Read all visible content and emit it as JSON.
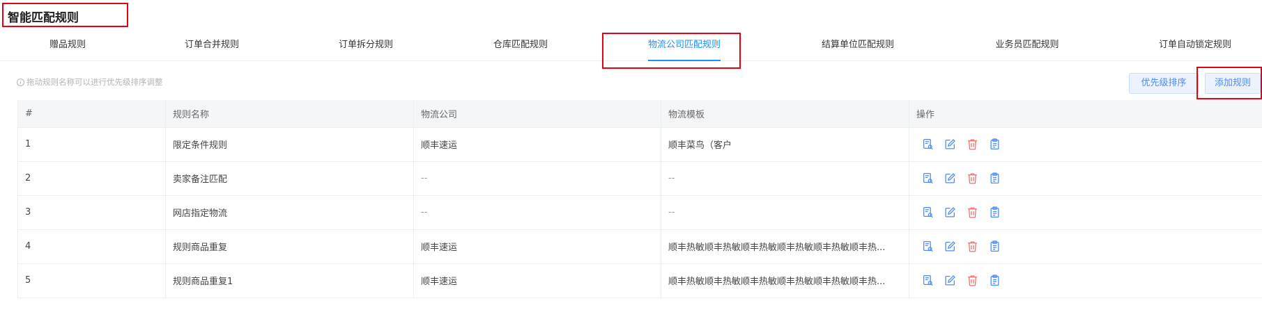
{
  "page": {
    "title": "智能匹配规则"
  },
  "colors": {
    "accent": "#1890ff",
    "highlight": "#e60012",
    "delete": "#f56c6c",
    "icon": "#4a8cf7"
  },
  "tabs": [
    {
      "label": "赠品规则",
      "active": false
    },
    {
      "label": "订单合并规则",
      "active": false
    },
    {
      "label": "订单拆分规则",
      "active": false
    },
    {
      "label": "仓库匹配规则",
      "active": false
    },
    {
      "label": "物流公司匹配规则",
      "active": true
    },
    {
      "label": "结算单位匹配规则",
      "active": false
    },
    {
      "label": "业务员匹配规则",
      "active": false
    },
    {
      "label": "订单自动锁定规则",
      "active": false
    }
  ],
  "toolbar": {
    "hint": "拖动规则名称可以进行优先级排序调整",
    "hint_icon": "info-circle-icon",
    "priority_label": "优先级排序",
    "add_label": "添加规则"
  },
  "table": {
    "headers": [
      "#",
      "规则名称",
      "物流公司",
      "物流模板",
      "操作"
    ],
    "rows": [
      {
        "index": "1",
        "name": "限定条件规则",
        "company": "顺丰速运",
        "template": "顺丰菜鸟（客户"
      },
      {
        "index": "2",
        "name": "卖家备注匹配",
        "company": "--",
        "template": "--"
      },
      {
        "index": "3",
        "name": "网店指定物流",
        "company": "--",
        "template": "--"
      },
      {
        "index": "4",
        "name": "规则商品重复",
        "company": "顺丰速运",
        "template": "顺丰热敏顺丰热敏顺丰热敏顺丰热敏顺丰热敏顺丰热..."
      },
      {
        "index": "5",
        "name": "规则商品重复1",
        "company": "顺丰速运",
        "template": "顺丰热敏顺丰热敏顺丰热敏顺丰热敏顺丰热敏顺丰热..."
      }
    ],
    "row_actions": [
      "view-detail-icon",
      "edit-icon",
      "delete-icon",
      "copy-icon"
    ]
  }
}
